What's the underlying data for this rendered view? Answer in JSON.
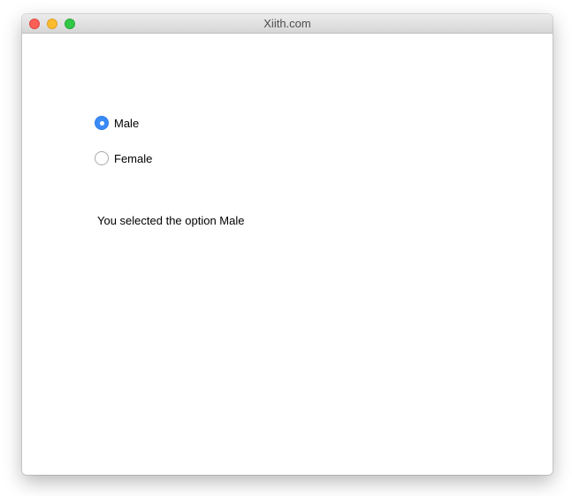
{
  "window": {
    "title": "Xiith.com"
  },
  "options": [
    {
      "label": "Male",
      "selected": true
    },
    {
      "label": "Female",
      "selected": false
    }
  ],
  "result_text": "You selected the option Male",
  "colors": {
    "accent": "#3a8bf7",
    "close": "#fc5f57",
    "minimize": "#fdbc2e",
    "zoom": "#33c748"
  }
}
